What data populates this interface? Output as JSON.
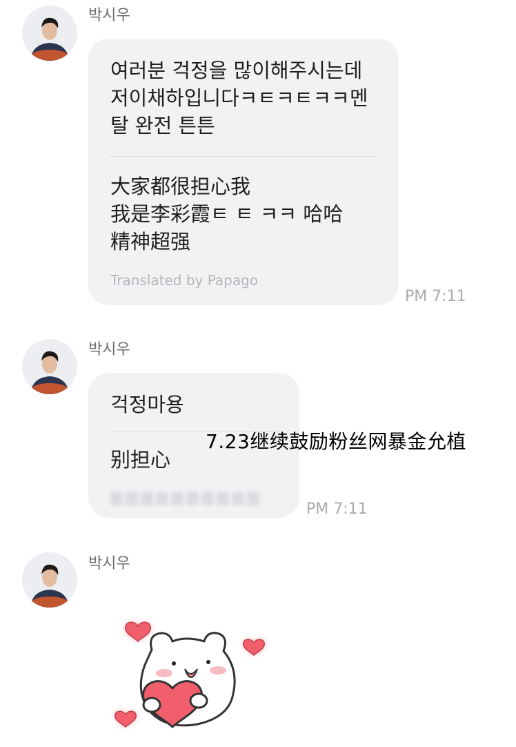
{
  "messages": [
    {
      "sender": "박시우",
      "original": "여러분 걱정을 많이해주시는데\n저이채하입니다ㅋㅌㅋㅌㅋㅋ멘\n탈 완전 튼튼",
      "translated": "大家都很担心我\n我是李彩霞ㅌ ㅌ ㅋㅋ 哈哈\n精神超强",
      "credit": "Translated by Papago",
      "time": "PM 7:11"
    },
    {
      "sender": "박시우",
      "original": "걱정마용",
      "translated": "别担心",
      "time": "PM 7:11"
    },
    {
      "sender": "박시우",
      "sticker": "bear-holding-heart-sticker"
    }
  ],
  "overlay": {
    "watermark": "7.23继续鼓励粉丝网暴金允植"
  },
  "colors": {
    "bubble": "#f1f2f4",
    "sender": "#6d6d6d",
    "time": "#a8aaae",
    "heart": "#f06a6e"
  }
}
